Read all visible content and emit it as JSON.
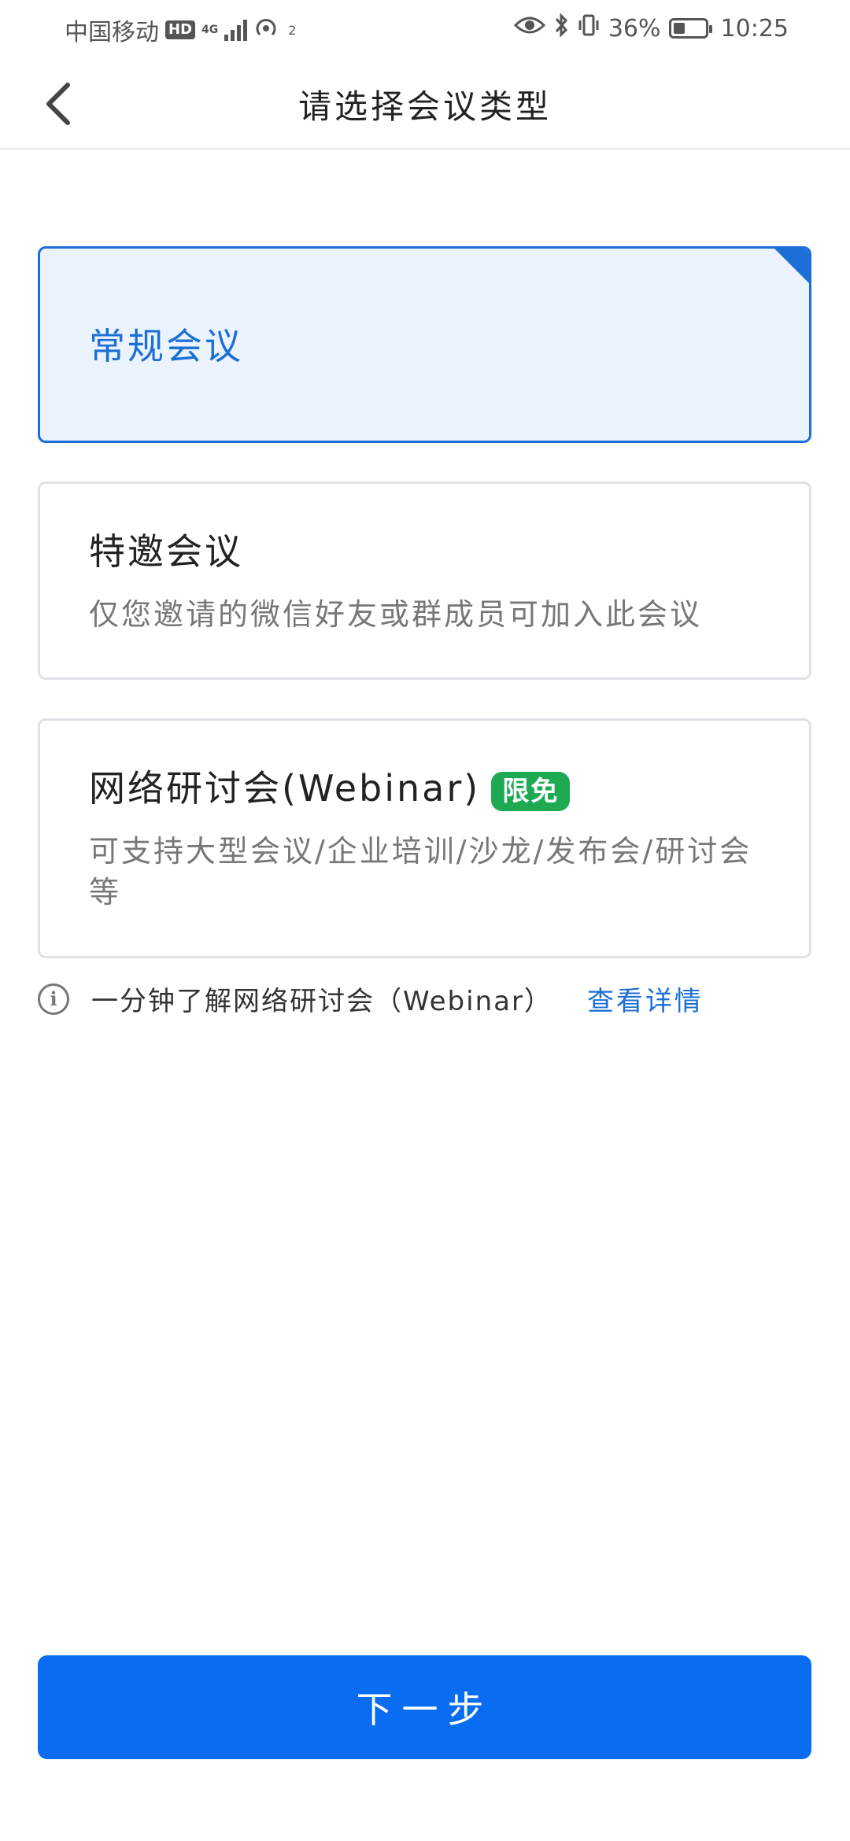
{
  "status_bar": {
    "carrier": "中国移动",
    "hd": "HD",
    "network": "4G",
    "hotspot_count": "2",
    "battery_percent": "36%",
    "battery_level": 0.36,
    "time": "10:25"
  },
  "nav": {
    "title": "请选择会议类型"
  },
  "options": [
    {
      "title": "常规会议",
      "selected": true
    },
    {
      "title": "特邀会议",
      "desc": "仅您邀请的微信好友或群成员可加入此会议",
      "selected": false
    },
    {
      "title": "网络研讨会(Webinar)",
      "tag": "限免",
      "desc": "可支持大型会议/企业培训/沙龙/发布会/研讨会等",
      "selected": false
    }
  ],
  "info": {
    "text": "一分钟了解网络研讨会（Webinar）",
    "link": "查看详情"
  },
  "next_button": "下一步",
  "colors": {
    "accent": "#1b6fd6",
    "primary_button": "#0a6cf0",
    "free_tag": "#1daa52",
    "selected_bg": "#eaf3fe"
  }
}
